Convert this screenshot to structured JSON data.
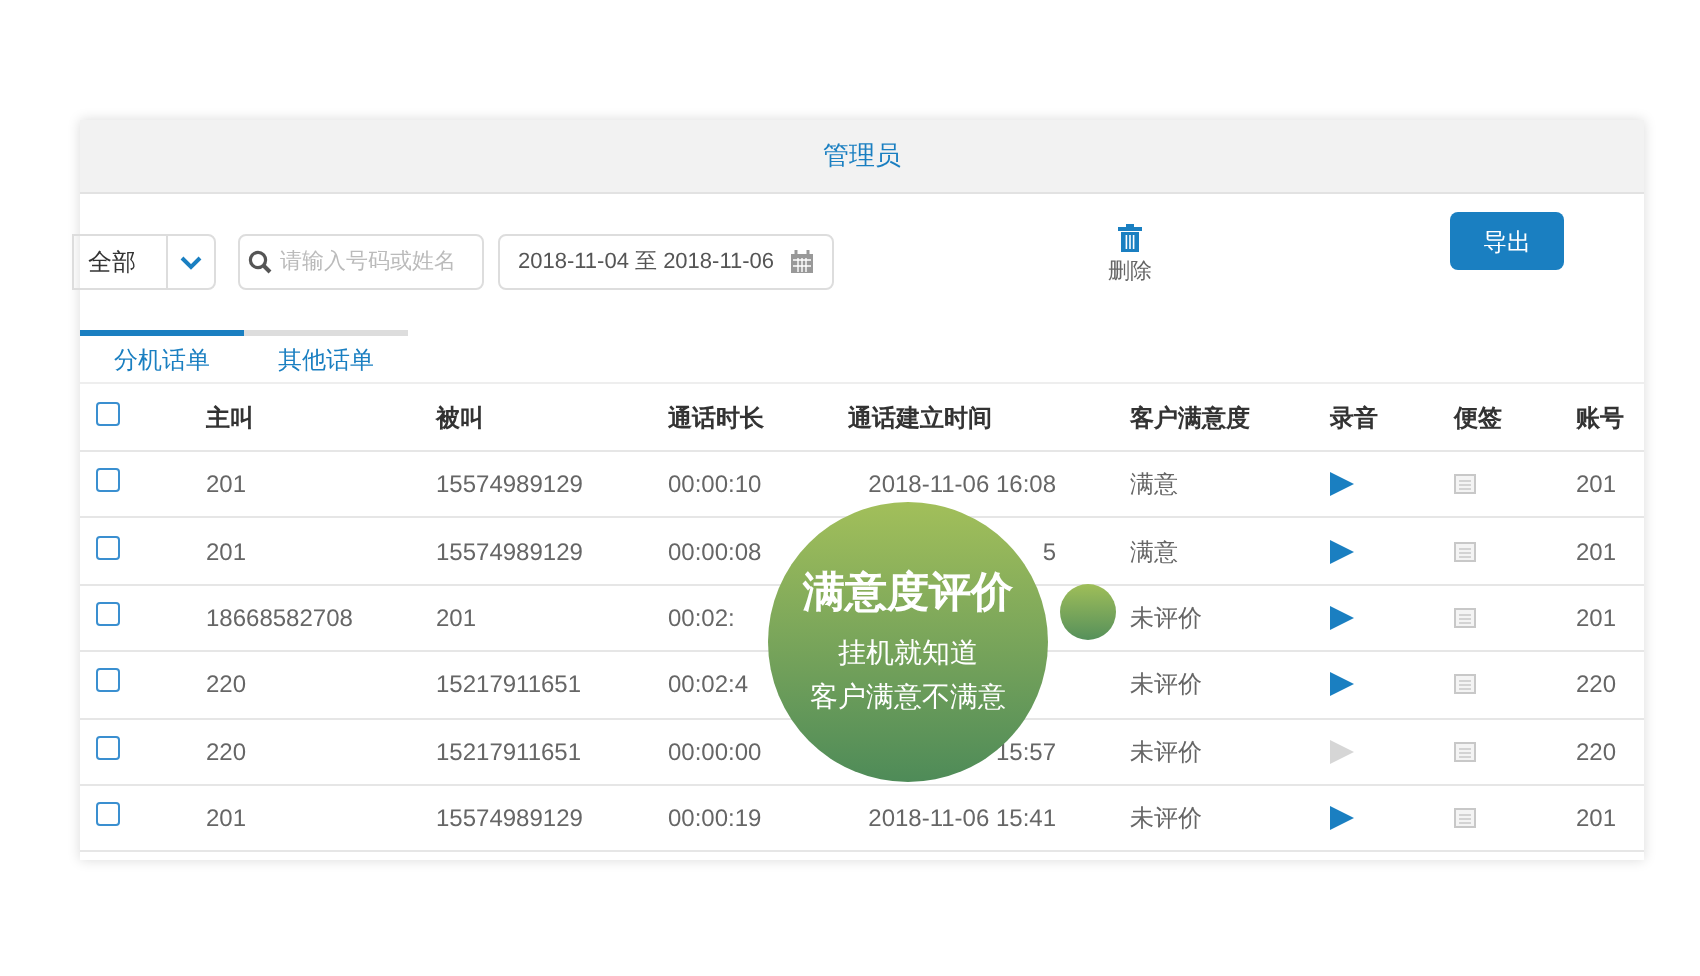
{
  "header": {
    "title": "管理员"
  },
  "toolbar": {
    "filter": {
      "value": "全部"
    },
    "search": {
      "placeholder": "请输入号码或姓名"
    },
    "date_range": {
      "value": "2018-11-04 至 2018-11-06"
    },
    "delete": {
      "label": "删除"
    },
    "export": {
      "label": "导出"
    }
  },
  "tabs": [
    {
      "label": "分机话单",
      "selected": true
    },
    {
      "label": "其他话单",
      "selected": false
    }
  ],
  "table": {
    "select_all": {
      "checked": false
    },
    "columns": [
      "主叫",
      "被叫",
      "通话时长",
      "通话建立时间",
      "客户满意度",
      "录音",
      "便签",
      "账号"
    ],
    "rows": [
      {
        "checked": false,
        "caller": "201",
        "callee": "15574989129",
        "duration": "00:00:10",
        "start_time": "2018-11-06 16:08",
        "satisfaction": "满意",
        "recording_available": true,
        "account": "201"
      },
      {
        "checked": false,
        "caller": "201",
        "callee": "15574989129",
        "duration": "00:00:08",
        "start_time": "5",
        "satisfaction": "满意",
        "recording_available": true,
        "account": "201"
      },
      {
        "checked": false,
        "caller": "18668582708",
        "callee": "201",
        "duration": "00:02:",
        "satisfaction": "未评价",
        "recording_available": true,
        "account": "201"
      },
      {
        "checked": false,
        "caller": "220",
        "callee": "15217911651",
        "duration": "00:02:4",
        "satisfaction": "未评价",
        "recording_available": true,
        "account": "220"
      },
      {
        "checked": false,
        "caller": "220",
        "callee": "15217911651",
        "duration": "00:00:00",
        "start_time": "15:57",
        "satisfaction": "未评价",
        "recording_available": false,
        "account": "220"
      },
      {
        "checked": false,
        "caller": "201",
        "callee": "15574989129",
        "duration": "00:00:19",
        "start_time": "2018-11-06 15:41",
        "satisfaction": "未评价",
        "recording_available": true,
        "account": "201"
      }
    ]
  },
  "promo": {
    "title": "满意度评价",
    "lines": [
      "挂机就知道",
      "客户满意不满意"
    ]
  }
}
